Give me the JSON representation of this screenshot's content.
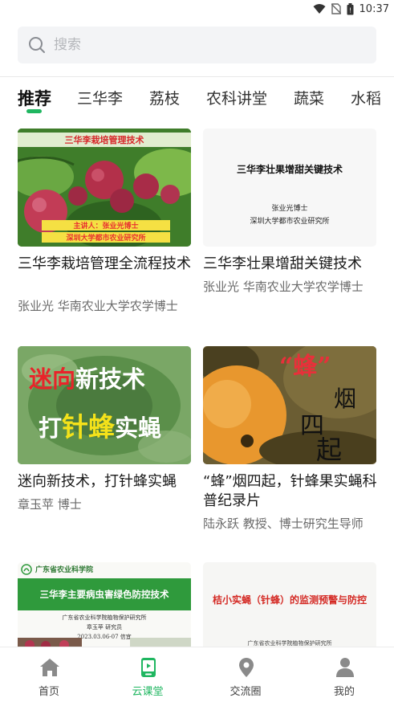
{
  "status_bar": {
    "time": "10:37"
  },
  "search": {
    "placeholder": "搜索"
  },
  "tabs": [
    {
      "label": "推荐",
      "active": true
    },
    {
      "label": "三华李"
    },
    {
      "label": "荔枝"
    },
    {
      "label": "农科讲堂"
    },
    {
      "label": "蔬菜"
    },
    {
      "label": "水稻"
    }
  ],
  "cards": [
    {
      "title": "三华李栽培管理全流程技术",
      "subtitle": "张业光 华南农业大学农学博士",
      "thumb": {
        "heading": "三华李栽培管理技术",
        "speaker_line": "主讲人：张业光博士",
        "org_line": "深圳大学都市农业研究所"
      }
    },
    {
      "title": "三华李壮果增甜关键技术",
      "subtitle": "张业光 华南农业大学农学博士",
      "thumb": {
        "heading": "三华李壮果增甜关键技术",
        "speaker_line": "张业光博士",
        "org_line": "深圳大学都市农业研究所"
      }
    },
    {
      "title": "迷向新技术，打针蜂实蝇",
      "subtitle": "章玉苹 博士",
      "thumb": {
        "line1_red": "迷向",
        "line1_white": "新技术",
        "line2_a": "打",
        "line2_b": "针蜂",
        "line2_c": "实蝇"
      }
    },
    {
      "title": "“蜂”烟四起，针蜂果实蝇科普纪录片",
      "subtitle": "陆永跃 教授、博士研究生导师",
      "thumb": {
        "quoted": "“蜂”",
        "c1": "烟",
        "c2": "四",
        "c3": "起"
      }
    },
    {
      "thumb": {
        "org_header": "广东省农业科学院",
        "banner": "三华李主要病虫害绿色防控技术",
        "institute": "广东省农业科学院植物保护研究所",
        "speaker": "章玉苹 研究员",
        "date": "2023.03.06-07 信宜"
      }
    },
    {
      "thumb": {
        "banner": "桔小实蝇（针蜂）的监测预警与防控",
        "footer": "广东省农业科学院植物保护研究所"
      }
    }
  ],
  "bottom_nav": [
    {
      "label": "首页",
      "icon": "home-icon"
    },
    {
      "label": "云课堂",
      "icon": "classroom-icon",
      "active": true
    },
    {
      "label": "交流圈",
      "icon": "location-pin-icon"
    },
    {
      "label": "我的",
      "icon": "user-icon"
    }
  ],
  "colors": {
    "accent": "#1fb660",
    "banner_green": "#2f9a3c"
  }
}
